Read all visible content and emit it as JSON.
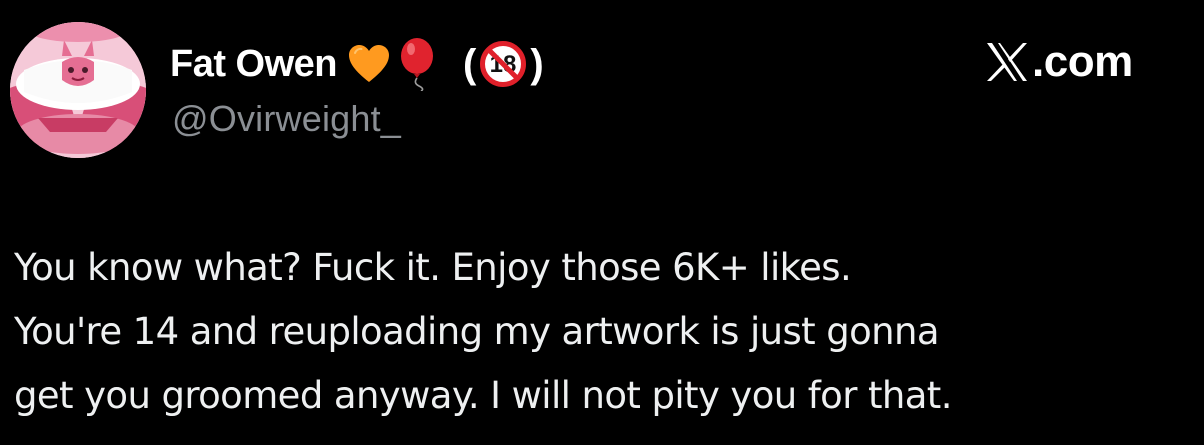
{
  "author": {
    "display_name": "Fat Owen",
    "handle": "@Ovirweight_",
    "name_badges": {
      "heart_icon": "orange-heart-icon",
      "balloon_icon": "red-balloon-icon",
      "paren_open": "(",
      "age_icon": "no-one-under-eighteen-icon",
      "age_text": "18",
      "paren_close": ")"
    },
    "avatar_icon": "pink-cartoon-avatar"
  },
  "site": {
    "logo_icon": "x-logo-icon",
    "label": ".com"
  },
  "tweet": {
    "lines": [
      "You know what? Fuck it. Enjoy those 6K+ likes.",
      "You're 14 and reuploading my artwork is just gonna",
      "get you groomed anyway. I will not pity you for that."
    ]
  },
  "colors": {
    "background": "#000000",
    "name": "#ffffff",
    "handle": "#8b8f94",
    "text": "#eef0f1",
    "heart": "#ff9a1f",
    "balloon": "#e0232e"
  }
}
